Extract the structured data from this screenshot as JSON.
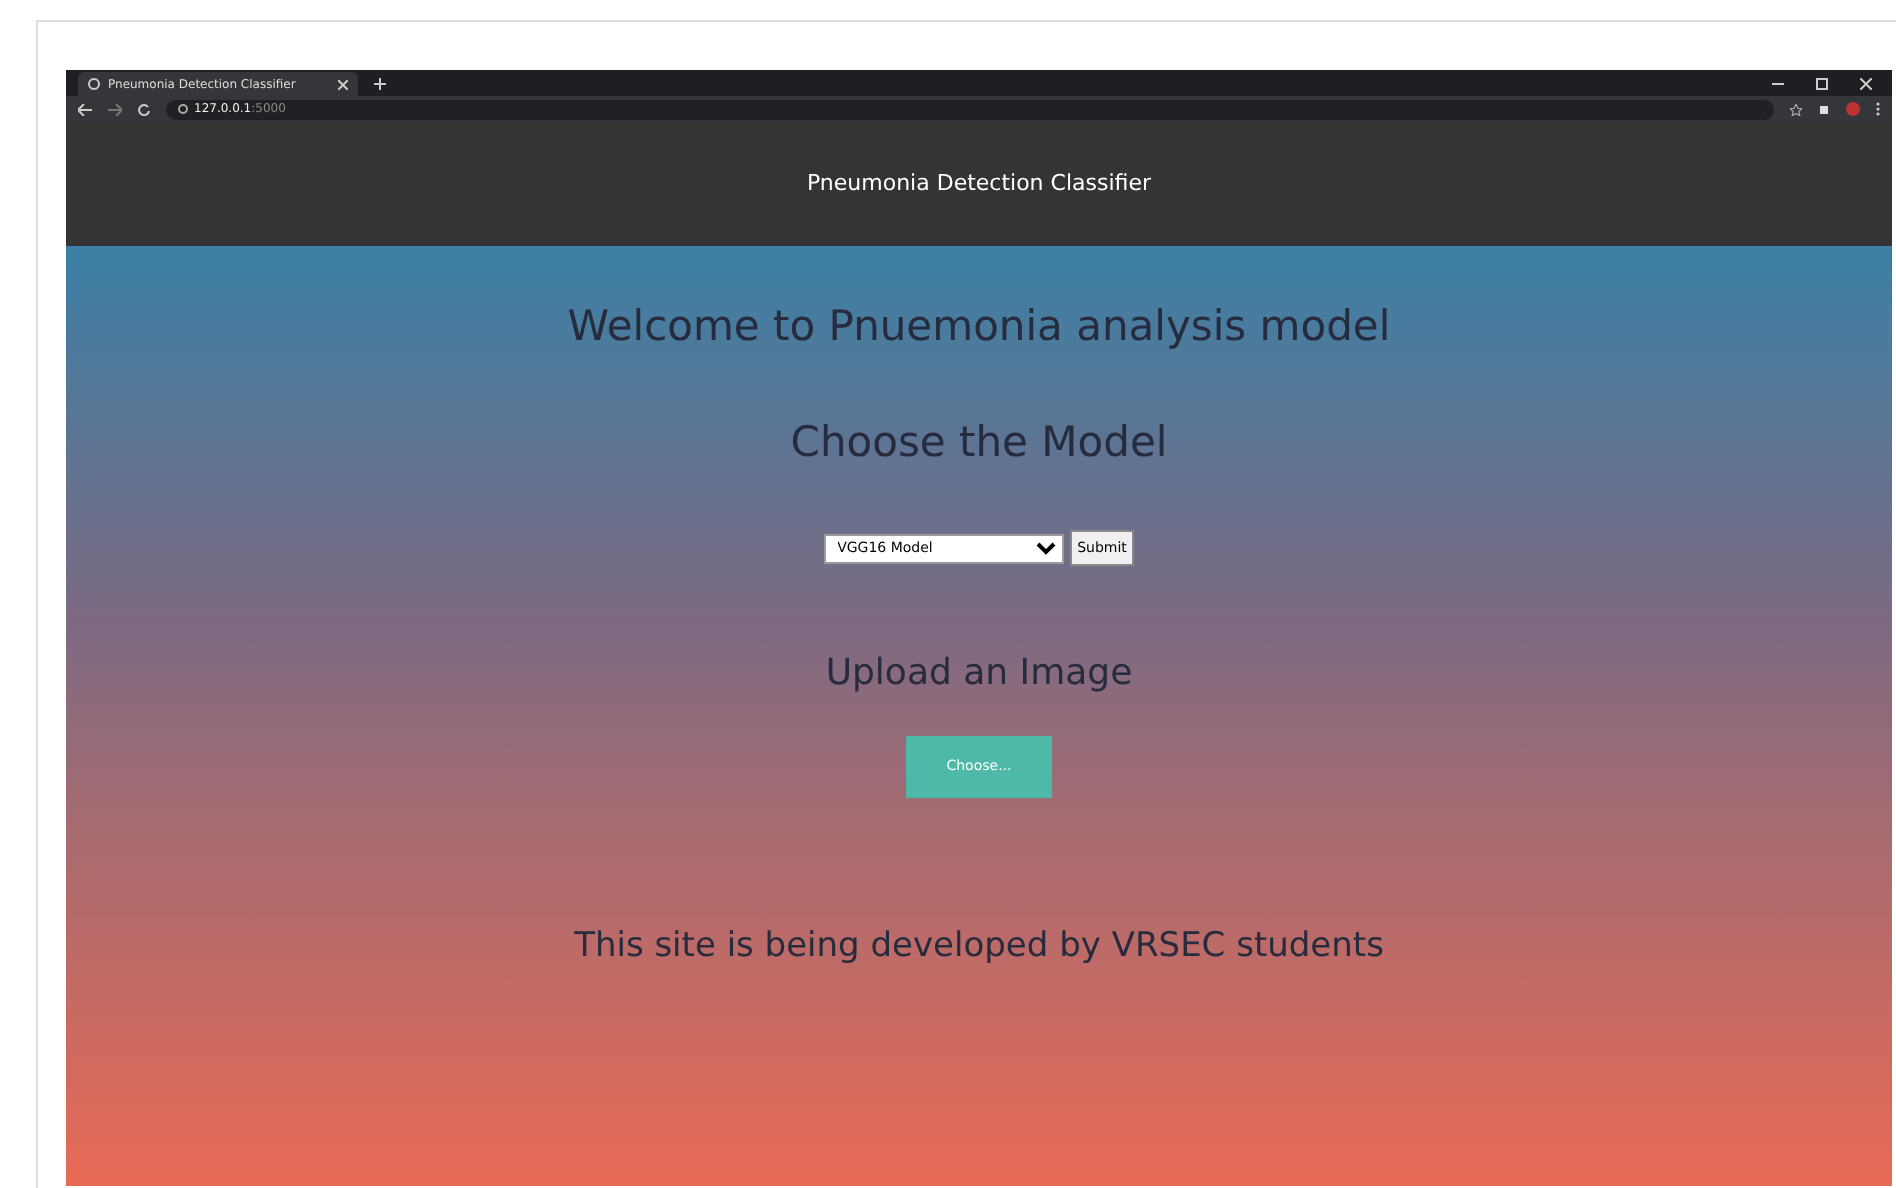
{
  "browser": {
    "tab_title": "Pneumonia Detection Classifier",
    "url_host": "127.0.0.1",
    "url_port": ":5000"
  },
  "header": {
    "title": "Pneumonia Detection Classifier"
  },
  "main": {
    "welcome": "Welcome to Pnuemonia analysis model",
    "choose_heading": "Choose the Model",
    "model_select": {
      "value": "VGG16 Model"
    },
    "submit_button": "Submit",
    "upload_heading": "Upload an Image",
    "choose_button": "Choose...",
    "footer_text": "This site is being developed by VRSEC students"
  }
}
